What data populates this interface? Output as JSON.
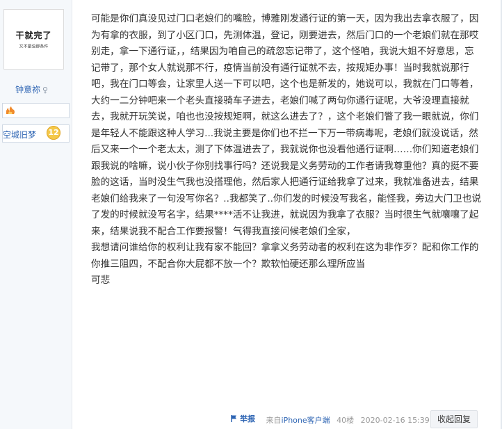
{
  "author": {
    "avatar_title": "干就完了",
    "avatar_subtitle": "又不是没那条件",
    "username": "钟意祢",
    "gender_symbol": "♀",
    "level_name": "空城旧梦",
    "level": "12"
  },
  "post": {
    "paragraphs": [
      "可能是你们真没见过门口老娘们的嘴脸，博雅刚发通行证的第一天，因为我出去拿衣服了，因为有拿的衣服，到了小区门口，先测体温，登记，刚要进去，然后门口的一个老娘们就在那哎别走，拿一下通行证，，结果因为咱自己的疏忽忘记带了，这个怪咱，我说大姐不好意思，忘记带了，那个女人就说那不行，疫情当前没有通行证就不去，按规矩办事！当时我就说那行吧，我在门口等会，让家里人送一下可以吧，这个也是新发的，她说可以，我就在门口等着，大约一二分钟吧来一个老头直接骑车子进去，老娘们喊了两句你通行证呢，大爷没理直接就去，我就开玩笑说，咱也也没按规矩啊，就这么进去了？，这个老娘们瞥了我一眼就说，你们是年轻人不能跟这种人学习...我说主要是你们也不拦一下万一带病毒呢，老娘们就没说话，然后又来一个一个老太太，测了下体温进去了，我就说你也没看他通行证啊……你们知道老娘们跟我说的啥嘛，说小伙子你别找事行吗？还说我是义务劳动的工作者请我尊重他？真的挺不要脸的这话，当时没生气我也没搭理他，然后家人把通行证给我拿了过来，我就准备进去，结果老娘们给我来了一句没写你名？..我都笑了..你们发的时候没写我名，能怪我，旁边大门卫也说了发的时候就没写名字，结果****活不让我进，就说因为我拿了衣服？当时很生气就嚷嚷了起来，结果说我不配合工作要报警！气得我直接问候老娘们全家，",
      "我想请问谁给你的权利让我有家不能回？拿拿义务劳动者的权利在这为非作歹？配和你工作的你推三阻四，不配合你大屁都不放一个？欺软怕硬还那么理所应当",
      "可悲"
    ]
  },
  "footer": {
    "report_label": "举报",
    "client_prefix": "来自",
    "client_name": "iPhone客户端",
    "floor": "40楼",
    "timestamp": "2020-02-16 15:39",
    "reply_label": "收起回复"
  },
  "colors": {
    "link": "#2d64b3",
    "muted": "#999999"
  }
}
